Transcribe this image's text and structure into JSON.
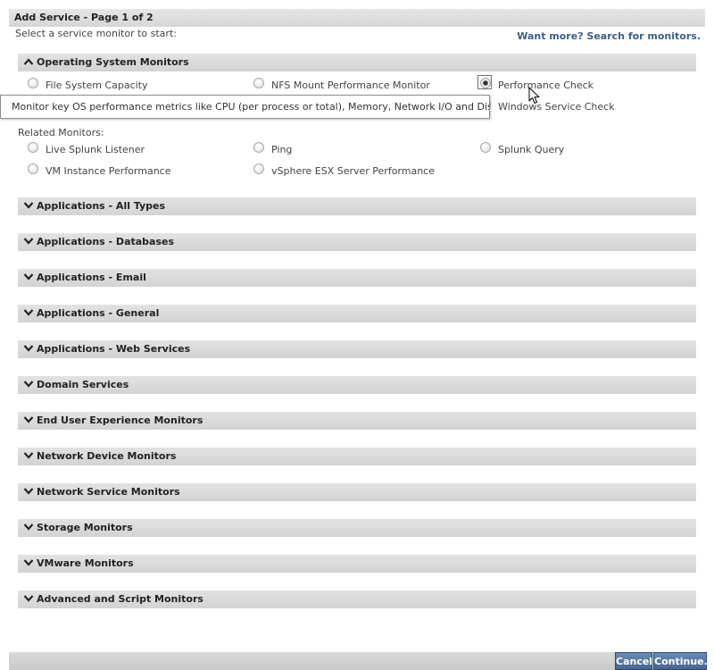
{
  "page": {
    "title": "Add Service - Page 1 of 2",
    "intro": "Select a service monitor to start:",
    "want_more": "Want more? Search for monitors."
  },
  "os_section": {
    "title": "Operating System Monitors",
    "expanded": true,
    "options": [
      {
        "label": "File System Capacity",
        "selected": false
      },
      {
        "label": "NFS Mount Performance Monitor",
        "selected": false
      },
      {
        "label": "Performance Check",
        "selected": true
      },
      {
        "label": "Windows Service Check",
        "selected": false
      }
    ],
    "related_label": "Related Monitors:",
    "related_options": [
      {
        "label": "Live Splunk Listener",
        "selected": false
      },
      {
        "label": "Ping",
        "selected": false
      },
      {
        "label": "Splunk Query",
        "selected": false
      },
      {
        "label": "VM Instance Performance",
        "selected": false
      },
      {
        "label": "vSphere ESX Server Performance",
        "selected": false
      }
    ]
  },
  "tooltip": {
    "text": "Monitor key OS performance metrics like CPU (per process or total), Memory, Network I/O and Disk I/O."
  },
  "sections": [
    {
      "title": "Applications - All Types",
      "expanded": false
    },
    {
      "title": "Applications - Databases",
      "expanded": false
    },
    {
      "title": "Applications - Email",
      "expanded": false
    },
    {
      "title": "Applications - General",
      "expanded": false
    },
    {
      "title": "Applications - Web Services",
      "expanded": false
    },
    {
      "title": "Domain Services",
      "expanded": false
    },
    {
      "title": "End User Experience Monitors",
      "expanded": false
    },
    {
      "title": "Network Device Monitors",
      "expanded": false
    },
    {
      "title": "Network Service Monitors",
      "expanded": false
    },
    {
      "title": "Storage Monitors",
      "expanded": false
    },
    {
      "title": "VMware Monitors",
      "expanded": false
    },
    {
      "title": "Advanced and Script Monitors",
      "expanded": false
    }
  ],
  "footer": {
    "cancel_label": "Cancel",
    "continue_label": "Continue..."
  },
  "icons": {
    "expanded": "chevron-up-icon",
    "collapsed": "chevron-down-icon",
    "cursor": "mouse-pointer-icon"
  },
  "colors": {
    "link": "#3e5f8a",
    "button": "#56779f",
    "header_bar": "#d9d9d9"
  }
}
